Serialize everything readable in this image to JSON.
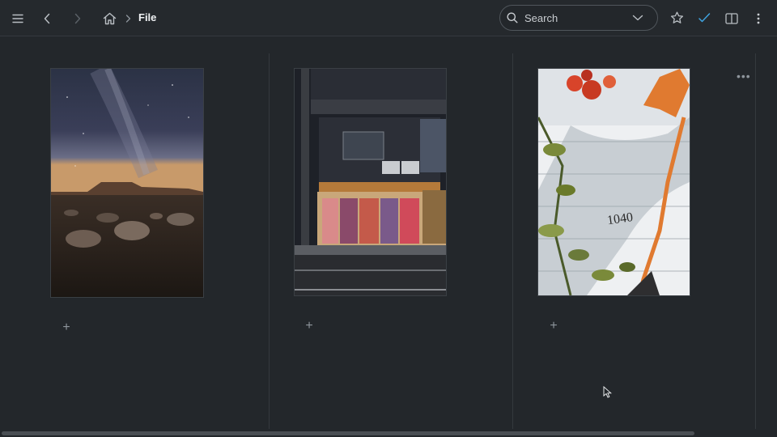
{
  "toolbar": {
    "breadcrumb_title": "File",
    "search_placeholder": "Search",
    "check_color": "#3fa3e0"
  },
  "icons": {
    "menu": "hamburger-icon",
    "back": "chevron-left-icon",
    "forward": "chevron-right-icon",
    "home": "home-icon",
    "separator": "chevron-right-icon",
    "search": "search-icon",
    "dropdown": "chevron-down-icon",
    "star": "star-icon",
    "check": "check-icon",
    "split": "split-view-icon",
    "more": "more-vertical-icon"
  },
  "columns": [
    {
      "photo": "desert-night-sky",
      "add_symbol": "+"
    },
    {
      "photo": "street-shop-night",
      "add_symbol": "+"
    },
    {
      "photo": "house-number-1040",
      "house_number": "1040",
      "add_symbol": "+",
      "more_symbol": "•••"
    }
  ]
}
